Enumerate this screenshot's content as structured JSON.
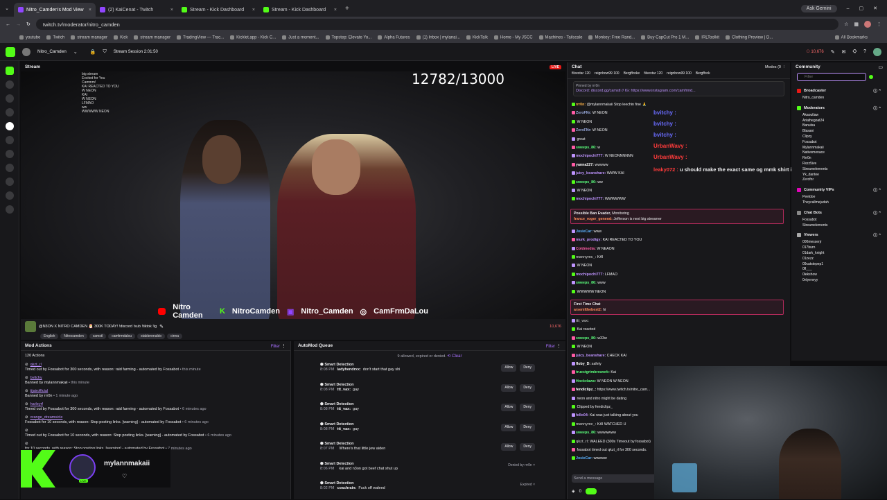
{
  "browser": {
    "tabs": [
      {
        "label": "Nitro_Camden's Mod View",
        "active": true,
        "color": "#9146ff"
      },
      {
        "label": "(2) KaiCenat - Twitch",
        "active": false,
        "color": "#9146ff"
      },
      {
        "label": "Stream - Kick Dashboard",
        "active": false,
        "color": "#53fc18"
      },
      {
        "label": "Stream - Kick Dashboard",
        "active": false,
        "color": "#53fc18"
      }
    ],
    "url": "twitch.tv/moderator/nitro_camden",
    "ask_gemini": "Ask Gemini",
    "bookmarks": [
      "youtube",
      "Twitch",
      "stream manager",
      "Kick",
      "stream manager",
      "TradingView — Trac...",
      "Kicklet.app - Kick C...",
      "Just a moment...",
      "Topstep: Elevate Yo...",
      "Alpha Futures",
      "(1) Inbox | mylanai...",
      "KickTalk",
      "Home - My JSCC",
      "Machines - Tailscale",
      "Monkey: Free Rand...",
      "Buy CapCut Pro 1 M...",
      "IRLToolkit",
      "Clothing Preview | D..."
    ],
    "all_bookmarks": "All Bookmarks"
  },
  "topnav": {
    "channel": "Nitro_Camden",
    "session": "Stream Session 2:01:50",
    "viewers": "10,676"
  },
  "stream": {
    "heading": "Stream",
    "live": "LIVE",
    "counter": "12782/13000",
    "banner_items": [
      "Nitro Camden",
      "NitroCamden",
      "Nitro_Camden",
      "CamFrmDaLou"
    ],
    "title": "@N3ON X NITRO CAMDEN 🎅 300K TODAY! !discord !sub !tiktok !ig",
    "tags": [
      "English",
      "Nitrocamden",
      "camstl",
      "camfrmdalou",
      "stablerenaldo",
      "cinna"
    ],
    "viewer_count": "10,676",
    "overlay_chat": [
      "big stream",
      "Excited for You",
      "Cammm!",
      "KAI REACTED TO YOU",
      "W NEON",
      "KAI",
      "W NEON",
      "LFMAO",
      "ww",
      "WWWWW NEON"
    ]
  },
  "mod_actions": {
    "heading": "Mod Actions",
    "filter": "Filter",
    "count": "120 Actions",
    "items": [
      {
        "user": "qkzt_rl",
        "text": "Timed out by Fossabot for 300 seconds, with reason: raid farming - automated by Fossabot",
        "time": "this minute"
      },
      {
        "user": "bvitchy",
        "text": "Banned by mylannmakaii",
        "time": "this minute"
      },
      {
        "user": "tijairofficial",
        "text": "Banned by rrr0n",
        "time": "1 minute ago"
      },
      {
        "user": "harleyrf",
        "text": "Timed out by Fossabot for 300 seconds, with reason: raid farming - automated by Fossabot",
        "time": "6 minutes ago"
      },
      {
        "user": "orange_dreamsicle",
        "text": "Fossabot for 10 seconds, with reason: Stop posting links. [warning] - automated by Fossabot",
        "time": "6 minutes ago"
      },
      {
        "user": "",
        "text": "Timed out by Fossabot for 10 seconds, with reason: Stop posting links. [warning] - automated by Fossabot",
        "time": "6 minutes ago"
      },
      {
        "user": "",
        "text": "for 10 seconds, with reason: Stop posting links. [warning] - automated by Fossabot",
        "time": "7 minutes ago"
      }
    ]
  },
  "automod": {
    "heading": "AutoMod Queue",
    "filter": "Filter",
    "summary": "9 allowed, expired or denied.",
    "clear": "Clear",
    "label": "Smart Detection",
    "allow": "Allow",
    "deny": "Deny",
    "items": [
      {
        "time": "8:08 PM",
        "user": "ladyhendrxx:",
        "msg": "don't start that gay shi",
        "status": ""
      },
      {
        "time": "8:08 PM",
        "user": "ttt_vax:",
        "msg": "gay",
        "status": ""
      },
      {
        "time": "8:08 PM",
        "user": "ttt_vax:",
        "msg": "gay",
        "status": ""
      },
      {
        "time": "8:08 PM",
        "user": "ttt_vax:",
        "msg": "gay",
        "status": ""
      },
      {
        "time": "8:07 PM",
        "user": "",
        "msg": "Where's that little jew aiden",
        "status": ""
      },
      {
        "time": "8:06 PM",
        "user": "",
        "msg": "kai and n3on got beef chat shut up",
        "status": "Denied by rrr0n"
      },
      {
        "time": "8:02 PM",
        "user": "coachrain:",
        "msg": "Fuck off waleed",
        "status": "Expired"
      }
    ]
  },
  "chat": {
    "heading": "Chat",
    "modes": "Modes (0",
    "top_users": [
      "filvestar 120",
      "reignbow99 100",
      "BergBroke",
      "filvestar 120",
      "reignbow99 100",
      "BergBrok"
    ],
    "pinned_by": "Pinned by rrr0n",
    "pinned_msg": "Discord: discord.gg/camstl // IG: https://www.instagram.com/camfrmd...",
    "overlay_names": [
      {
        "name": "bvitchy :",
        "color": "#6a6cff"
      },
      {
        "name": "bvitchy :",
        "color": "#6a6cff"
      },
      {
        "name": "bvitchy :",
        "color": "#6a6cff"
      },
      {
        "name": "UrbanWavy :",
        "color": "#ff3b3b"
      },
      {
        "name": "UrbanWavy :",
        "color": "#ff3b3b"
      }
    ],
    "overlay_msg": {
      "name": "leaky072 :",
      "text": "u should make the exact same og mmk shirt in lrl"
    },
    "messages": [
      {
        "name": "rrr0n:",
        "color": "#ffb347",
        "text": "@mylannmakaii Stop leechin fine 🙏"
      },
      {
        "name": "ZeroFNr:",
        "color": "#9ad",
        "text": "W NEON"
      },
      {
        "name": "",
        "color": "#ff5ba5",
        "text": "W NEON"
      },
      {
        "name": "ZeroFNr:",
        "color": "#9ad",
        "text": "W NEON"
      },
      {
        "name": "",
        "color": "#bf94ff",
        "text": "great"
      },
      {
        "name": "sweeps_86:",
        "color": "#5bff7c",
        "text": "w"
      },
      {
        "name": "mochipochi777:",
        "color": "#bf94ff",
        "text": "W NEONNNNNN"
      },
      {
        "name": "yanna227:",
        "color": "#fff",
        "text": "wwwww"
      },
      {
        "name": "juicy_beanshare:",
        "color": "#bf94ff",
        "text": "WWW KAI"
      },
      {
        "name": "sweeps_86:",
        "color": "#5bff7c",
        "text": "ww"
      },
      {
        "name": "",
        "color": "#ff5ba5",
        "text": "W NEON"
      },
      {
        "name": "mochipochi777:",
        "color": "#bf94ff",
        "text": "WWWWWW"
      }
    ],
    "ban_evader": {
      "label": "Possible Ban Evader,",
      "status": "Monitoring",
      "name": "france_roger_general:",
      "text": "Jefferson is next big streamer"
    },
    "messages2": [
      {
        "name": "JosieCar:",
        "color": "#5bb2ff",
        "text": "www"
      },
      {
        "name": "murk_prodigy:",
        "color": "#bf94ff",
        "text": "KAI REACTED TO YOU"
      },
      {
        "name": "Coldmedia:",
        "color": "#ff5ba5",
        "text": "W NEAON"
      },
      {
        "name": "mannymc_:",
        "color": "#aaa",
        "text": "KAI"
      },
      {
        "name": "",
        "color": "#ff5ba5",
        "text": "W NEON"
      },
      {
        "name": "mochipochi777:",
        "color": "#bf94ff",
        "text": "LFMAO"
      },
      {
        "name": "sweeps_86:",
        "color": "#5bff7c",
        "text": "www"
      },
      {
        "name": "",
        "color": "#ff5ba5",
        "text": "WWWWW NEON"
      }
    ],
    "first_time": {
      "label": "First Time Chat",
      "name": "arsenilthebest2:",
      "text": "hi"
    },
    "messages3": [
      {
        "name": "ttt_vax:",
        "color": "#aaa",
        "text": ""
      },
      {
        "name": "",
        "color": "#ff5ba5",
        "text": "Kai reacted"
      },
      {
        "name": "sweeps_86:",
        "color": "#5bff7c",
        "text": "w33w"
      },
      {
        "name": "",
        "color": "#ff5ba5",
        "text": "W NEON"
      },
      {
        "name": "juicy_beanshare:",
        "color": "#bf94ff",
        "text": "CHECK KAI"
      },
      {
        "name": "floby_D:",
        "color": "#fff",
        "text": "safety"
      },
      {
        "name": "truestgrimbrowork:",
        "color": "#5bff7c",
        "text": "Kai"
      },
      {
        "name": "Hockclaws:",
        "color": "#5bff7c",
        "text": "W NEON W NEON"
      },
      {
        "name": "fendiclipz_:",
        "color": "#fff",
        "text": "https://www.twitch.tv/nitro_cam..."
      },
      {
        "name": "",
        "color": "#fff",
        "text": "neon and nitro might be dating"
      },
      {
        "name": "",
        "color": "#aaa",
        "text": "Clipped by fendiclipz_"
      },
      {
        "name": "fello04:",
        "color": "#bf94ff",
        "text": "Kai was just talking about you"
      },
      {
        "name": "mannymc_:",
        "color": "#aaa",
        "text": "KAI WATCHED U"
      },
      {
        "name": "sweeps_86:",
        "color": "#5bff7c",
        "text": "wwwwwww"
      },
      {
        "name": "qkzt_rl:",
        "color": "#aaa",
        "text": "WALEED  (300s Timeout by fossabot)"
      },
      {
        "name": "",
        "color": "#aaa",
        "text": "fossabot timed out qkzt_rl for 300 seconds."
      },
      {
        "name": "JosieCar:",
        "color": "#5bb2ff",
        "text": "wwwww"
      }
    ],
    "send_placeholder": "Send a message",
    "points": "0"
  },
  "community": {
    "heading": "Community",
    "filter_placeholder": "Filter",
    "broadcaster_label": "Broadcaster",
    "broadcaster": [
      "Nitro_camden"
    ],
    "moderators_label": "Moderators",
    "moderators": [
      "Akaoutlaw",
      "Ariathegoat24",
      "Banulsa",
      "Blasani",
      "Clipzy",
      "Fossabot",
      "Mylannmakaii",
      "Nativemenace",
      "Rrr0n",
      "Rxzz5ive",
      "Streamelements",
      "Yk_dantee",
      "Zerofnr"
    ],
    "vips_label": "Community VIPs",
    "vips": [
      "Peeldoe",
      "Theycallmejudah"
    ],
    "bots_label": "Chat Bots",
    "bots": [
      "Fossabot",
      "Streamelements"
    ],
    "viewers_label": "Viewers",
    "viewers": [
      "000messerjr",
      "017burn",
      "01dark_knight",
      "01zezz",
      "09catstepep1",
      "0fl___",
      "0lekshow",
      "0nlyenvyy"
    ]
  },
  "miniplayer": {
    "name": "mylannmakaii",
    "live": "LIVE"
  }
}
